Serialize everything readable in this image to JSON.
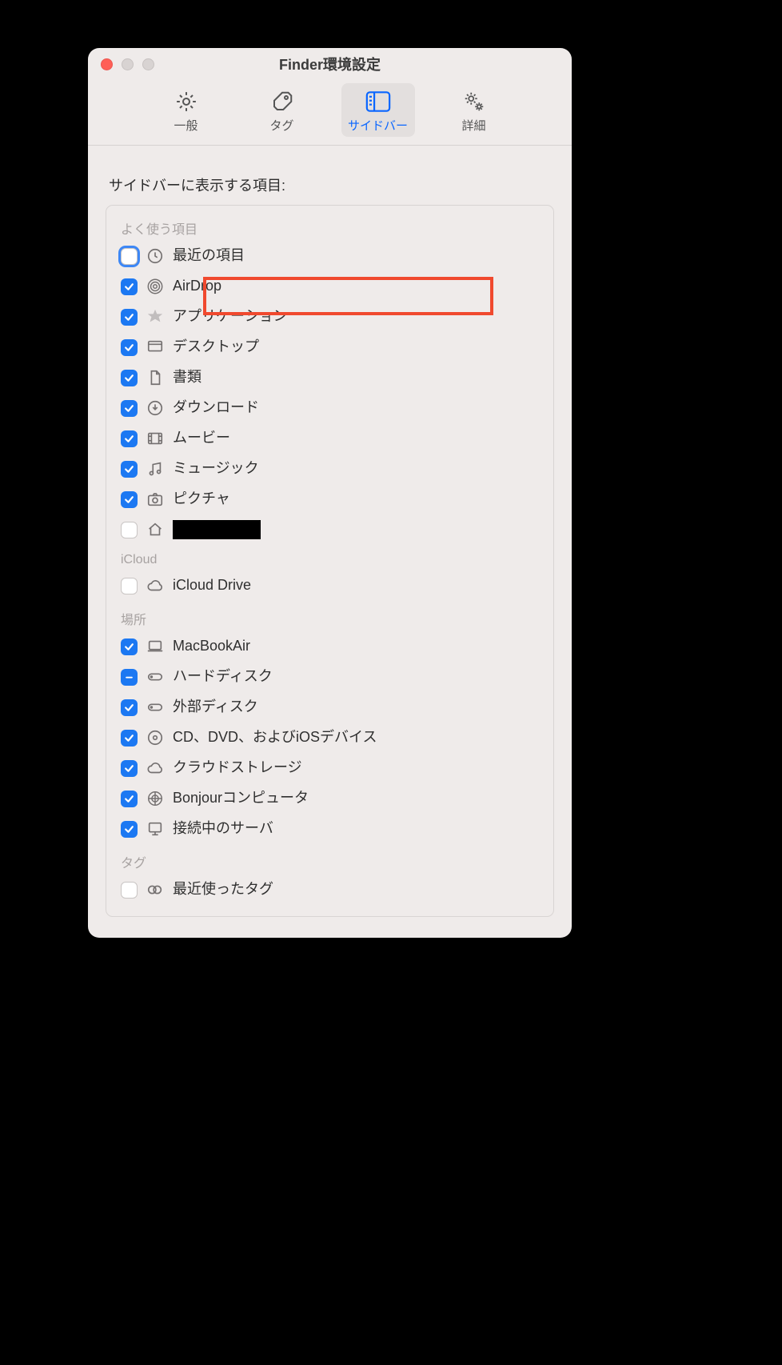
{
  "window": {
    "title": "Finder環境設定"
  },
  "toolbar": {
    "general": "一般",
    "tags": "タグ",
    "sidebar": "サイドバー",
    "advanced": "詳細"
  },
  "section_heading": "サイドバーに表示する項目:",
  "groups": {
    "favorites": "よく使う項目",
    "icloud": "iCloud",
    "locations": "場所",
    "tags": "タグ"
  },
  "items": {
    "recent": {
      "label": "最近の項目",
      "checked": "unchecked"
    },
    "airdrop": {
      "label": "AirDrop",
      "checked": "checked"
    },
    "apps": {
      "label": "アプリケーション",
      "checked": "checked"
    },
    "desktop": {
      "label": "デスクトップ",
      "checked": "checked"
    },
    "documents": {
      "label": "書類",
      "checked": "checked"
    },
    "downloads": {
      "label": "ダウンロード",
      "checked": "checked"
    },
    "movies": {
      "label": "ムービー",
      "checked": "checked"
    },
    "music": {
      "label": "ミュージック",
      "checked": "checked"
    },
    "pictures": {
      "label": "ピクチャ",
      "checked": "checked"
    },
    "home": {
      "label": "",
      "checked": "unchecked"
    },
    "iclouddrive": {
      "label": "iCloud Drive",
      "checked": "unchecked"
    },
    "thismac": {
      "label": "MacBookAir",
      "checked": "checked"
    },
    "harddisks": {
      "label": "ハードディスク",
      "checked": "mixed"
    },
    "extdisks": {
      "label": "外部ディスク",
      "checked": "checked"
    },
    "opticals": {
      "label": "CD、DVD、およびiOSデバイス",
      "checked": "checked"
    },
    "cloud": {
      "label": "クラウドストレージ",
      "checked": "checked"
    },
    "bonjour": {
      "label": "Bonjourコンピュータ",
      "checked": "checked"
    },
    "servers": {
      "label": "接続中のサーバ",
      "checked": "checked"
    },
    "recenttags": {
      "label": "最近使ったタグ",
      "checked": "unchecked"
    }
  }
}
